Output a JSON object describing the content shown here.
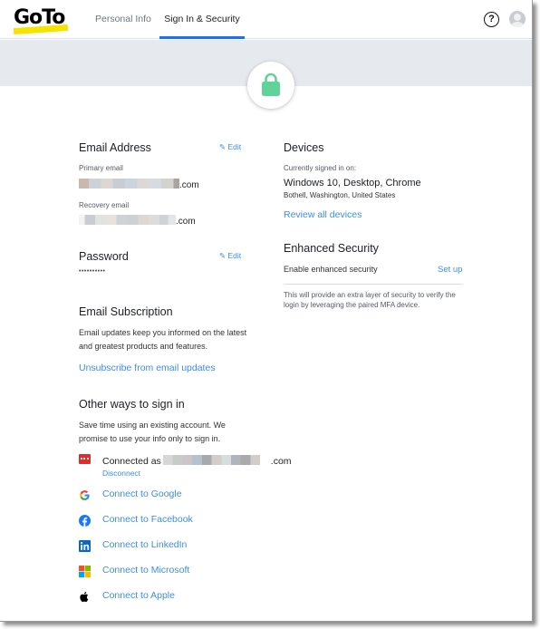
{
  "header": {
    "logo_text": "GoTo",
    "tabs": [
      {
        "label": "Personal Info",
        "active": false
      },
      {
        "label": "Sign In & Security",
        "active": true
      }
    ],
    "help_icon": "?",
    "accent_color": "#1a73e8"
  },
  "banner": {
    "badge_icon": "lock-icon",
    "badge_color": "#5fd39a"
  },
  "email_address": {
    "title": "Email Address",
    "edit_label": "Edit",
    "primary_label": "Primary email",
    "primary_value_suffix": ".com",
    "recovery_label": "Recovery email",
    "recovery_value_suffix": ".com"
  },
  "password": {
    "title": "Password",
    "edit_label": "Edit",
    "masked_value": "••••••••••"
  },
  "email_subscription": {
    "title": "Email Subscription",
    "description": "Email updates keep you informed on the latest and greatest products and features.",
    "unsubscribe_label": "Unsubscribe from email updates"
  },
  "other_sign_in": {
    "title": "Other ways to sign in",
    "description": "Save time using an existing account. We promise to use your info only to sign in.",
    "connected": {
      "prefix": "Connected as",
      "suffix": ".com",
      "disconnect_label": "Disconnect"
    },
    "providers": [
      {
        "name": "Google",
        "label": "Connect to Google",
        "icon": "google-icon"
      },
      {
        "name": "Facebook",
        "label": "Connect to Facebook",
        "icon": "facebook-icon"
      },
      {
        "name": "LinkedIn",
        "label": "Connect to LinkedIn",
        "icon": "linkedin-icon"
      },
      {
        "name": "Microsoft",
        "label": "Connect to Microsoft",
        "icon": "microsoft-icon"
      },
      {
        "name": "Apple",
        "label": "Connect to Apple",
        "icon": "apple-icon"
      }
    ]
  },
  "devices": {
    "title": "Devices",
    "current_label": "Currently signed in on:",
    "current_device": "Windows 10, Desktop, Chrome",
    "current_location": "Bothell, Washington, United States",
    "review_label": "Review all devices"
  },
  "enhanced_security": {
    "title": "Enhanced Security",
    "enable_label": "Enable enhanced security",
    "setup_label": "Set up",
    "note": "This will provide an extra layer of security to verify the login by leveraging the paired MFA device."
  },
  "colors": {
    "link": "#3b8ee8",
    "banner_bg": "#e6e9ee",
    "logo_underline": "#f7e300"
  }
}
